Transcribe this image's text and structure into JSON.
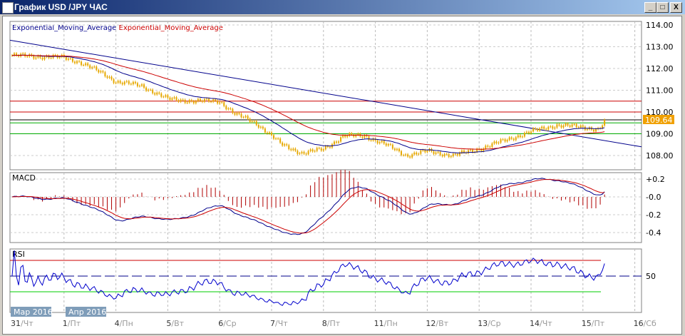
{
  "window": {
    "title": "График USD /JPY  ЧАС",
    "minimize": "_",
    "maximize": "□",
    "close": "X"
  },
  "legend": {
    "ema1": "Exponential_Moving_Average",
    "ema2": "Exponential_Moving_Average",
    "ema1_color": "#00008b",
    "ema2_color": "#cc0000"
  },
  "price_axis": [
    "114.00",
    "113.00",
    "112.00",
    "111.00",
    "110.00",
    "109.00",
    "108.00"
  ],
  "current_price": "109.64",
  "macd": {
    "title": "MACD",
    "ticks": [
      "+0.2",
      "-0.0",
      "-0.2",
      "-0.4"
    ]
  },
  "rsi": {
    "title": "RSI",
    "ticks": [
      "50"
    ]
  },
  "month_labels": [
    "Мар 2016",
    "Апр 2016"
  ],
  "x_labels": [
    [
      "31",
      "Чт"
    ],
    [
      "1",
      "Пт"
    ],
    [
      "4",
      "Пн"
    ],
    [
      "5",
      "Вт"
    ],
    [
      "6",
      "Ср"
    ],
    [
      "7",
      "Чт"
    ],
    [
      "8",
      "Пт"
    ],
    [
      "11",
      "Пн"
    ],
    [
      "12",
      "Вт"
    ],
    [
      "13",
      "Ср"
    ],
    [
      "14",
      "Чт"
    ],
    [
      "15",
      "Пт"
    ],
    [
      "16",
      "Сб"
    ]
  ],
  "chart_data": {
    "type": "candlestick",
    "symbol": "USD/JPY",
    "timeframe": "H1",
    "price_anchors_day_index": [
      0,
      1,
      1.3,
      1.8,
      2,
      2.5,
      3,
      3.5,
      4,
      4.3,
      4.7,
      5.2,
      5.6,
      6,
      6.4,
      6.8,
      7.2,
      7.6,
      8,
      8.5,
      9,
      9.5,
      10,
      10.5,
      11,
      11.3,
      11.45
    ],
    "price_anchors": [
      112.6,
      112.5,
      112.3,
      111.7,
      111.4,
      111.2,
      110.6,
      110.5,
      110.5,
      109.9,
      109.5,
      108.5,
      108.1,
      108.3,
      108.9,
      108.9,
      108.5,
      108.0,
      108.2,
      108.0,
      108.3,
      108.7,
      109.1,
      109.4,
      109.3,
      109.2,
      109.64
    ],
    "hlines": [
      {
        "value": 110.5,
        "color": "#cc0000"
      },
      {
        "value": 110.0,
        "color": "#cc0000"
      },
      {
        "value": 109.64,
        "color": "#000000"
      },
      {
        "value": 109.5,
        "color": "#00aa00"
      },
      {
        "value": 109.0,
        "color": "#00aa00"
      }
    ],
    "trendline": [
      113.3,
      108.4
    ],
    "ylim": [
      107.6,
      114.2
    ],
    "rsi_levels": [
      70,
      30,
      50
    ]
  }
}
